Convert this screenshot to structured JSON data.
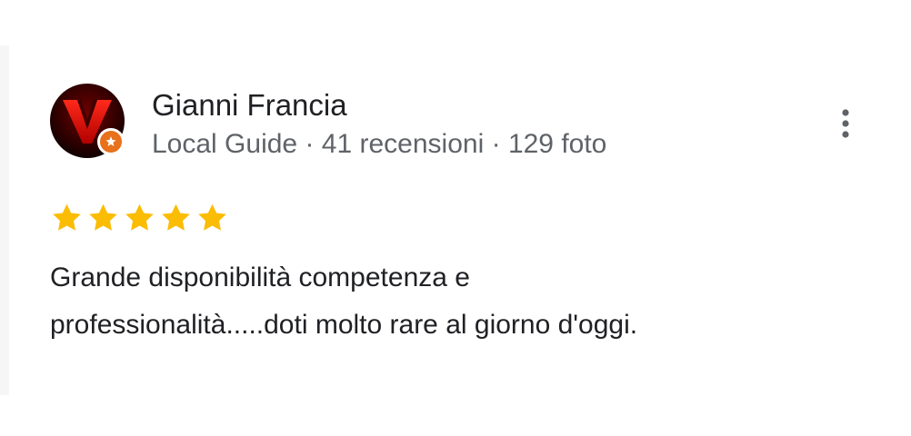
{
  "review": {
    "author": {
      "name": "Gianni Francia",
      "badge": "Local Guide",
      "separator": "·",
      "reviews_count": "41 recensioni",
      "photos_count": "129 foto",
      "avatar_icon": "red-v-logo",
      "badge_icon": "local-guide-star-icon"
    },
    "rating": 5,
    "rating_max": 5,
    "star_color": "#fbbc04",
    "text_line1": "Grande disponibilità competenza e",
    "text_line2": "professionalità.....doti molto rare al giorno d'oggi.",
    "menu_icon": "more-vert-icon"
  }
}
